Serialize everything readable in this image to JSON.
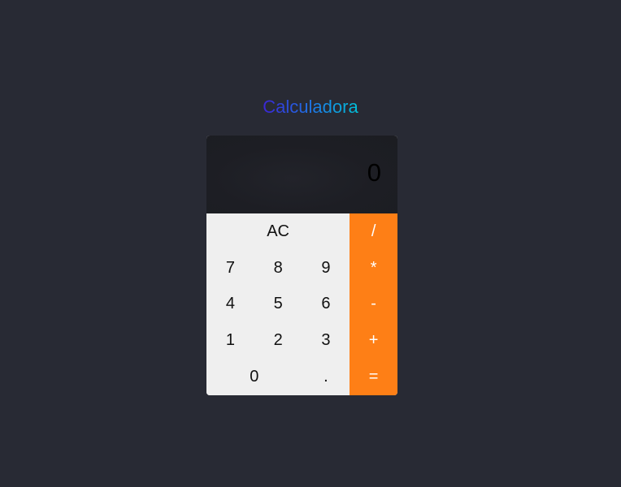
{
  "app": {
    "title": "Calculadora"
  },
  "display": {
    "value": "0"
  },
  "keys": {
    "clear": "AC",
    "divide": "/",
    "multiply": "*",
    "subtract": "-",
    "add": "+",
    "equals": "=",
    "seven": "7",
    "eight": "8",
    "nine": "9",
    "four": "4",
    "five": "5",
    "six": "6",
    "one": "1",
    "two": "2",
    "three": "3",
    "zero": "0",
    "decimal": "."
  },
  "colors": {
    "background": "#282a34",
    "display_bg": "#1d1e24",
    "keypad_bg": "#efefef",
    "operator_bg": "#fe7f16",
    "title_gradient_start": "#3b24d4",
    "title_gradient_end": "#00c2d9"
  }
}
